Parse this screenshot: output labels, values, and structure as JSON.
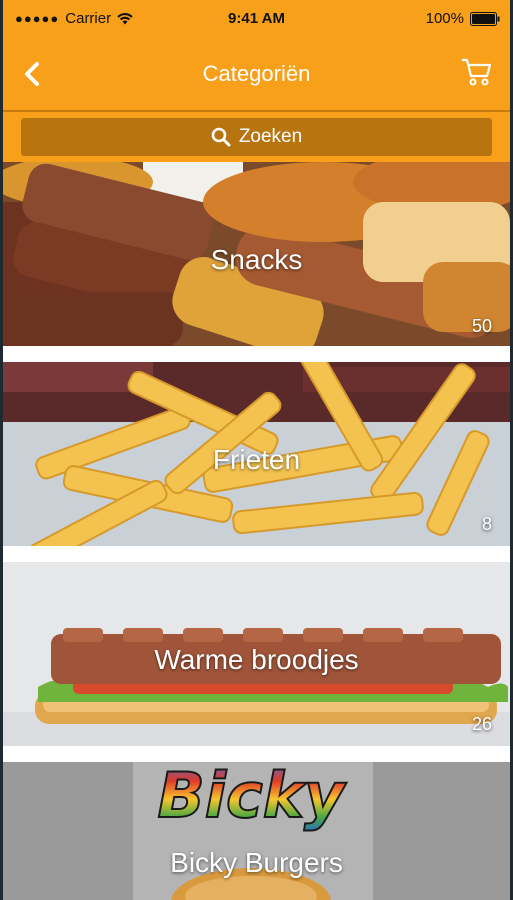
{
  "status_bar": {
    "signal_dots": "●●●●●",
    "carrier": "Carrier",
    "time": "9:41 AM",
    "battery": "100%"
  },
  "nav": {
    "title": "Categoriën",
    "back_icon": "chevron-left-icon",
    "cart_icon": "shopping-cart-icon"
  },
  "search": {
    "label": "Zoeken",
    "icon": "search-icon"
  },
  "categories": [
    {
      "label": "Snacks",
      "count": "50"
    },
    {
      "label": "Frieten",
      "count": "8"
    },
    {
      "label": "Warme broodjes",
      "count": "26"
    },
    {
      "label": "Bicky Burgers",
      "count": ""
    }
  ],
  "brand_logo_text": "Bicky",
  "colors": {
    "header": "#f9a01b",
    "search_bar": "#b8740f",
    "text": "#ffffff"
  }
}
